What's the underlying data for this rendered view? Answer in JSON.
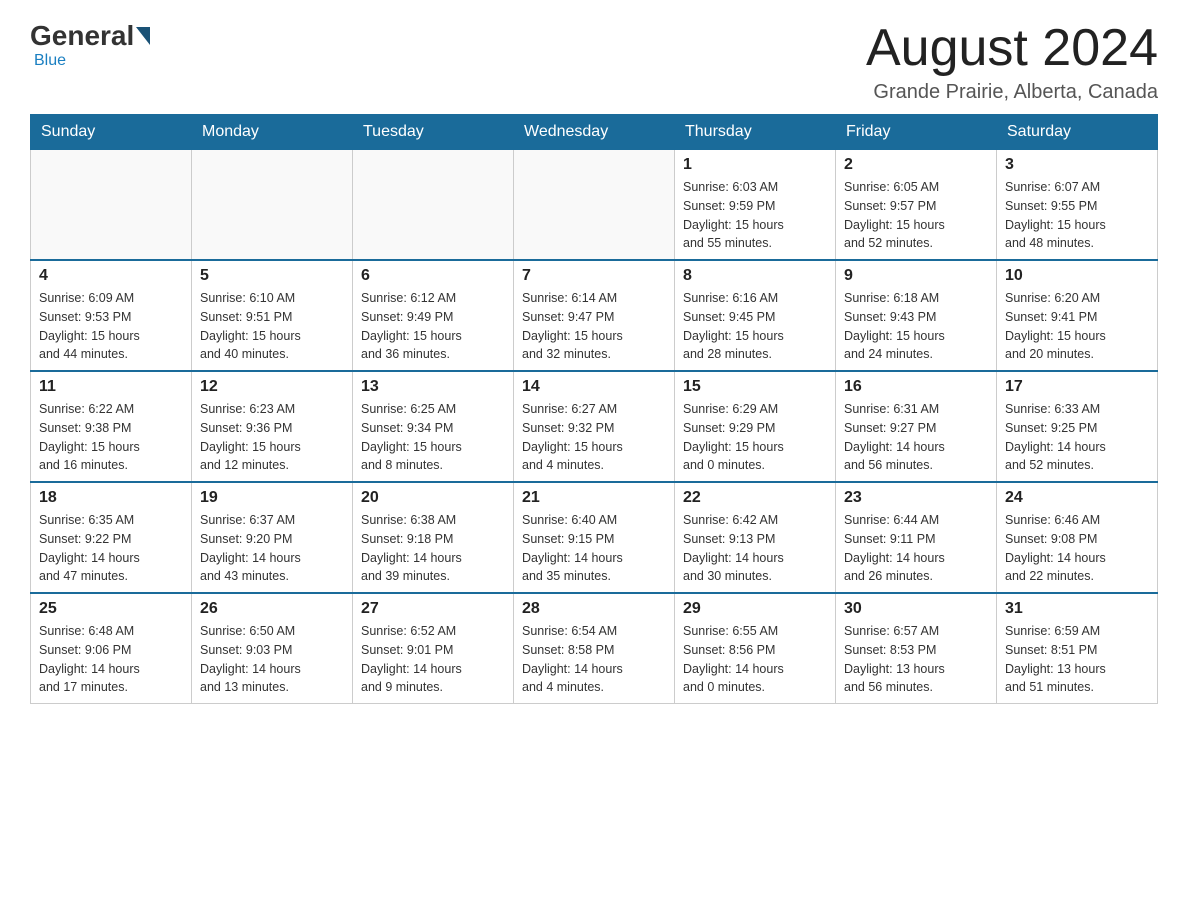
{
  "header": {
    "logo_general": "General",
    "logo_blue": "Blue",
    "month_title": "August 2024",
    "location": "Grande Prairie, Alberta, Canada"
  },
  "days_of_week": [
    "Sunday",
    "Monday",
    "Tuesday",
    "Wednesday",
    "Thursday",
    "Friday",
    "Saturday"
  ],
  "weeks": [
    [
      {
        "num": "",
        "info": ""
      },
      {
        "num": "",
        "info": ""
      },
      {
        "num": "",
        "info": ""
      },
      {
        "num": "",
        "info": ""
      },
      {
        "num": "1",
        "info": "Sunrise: 6:03 AM\nSunset: 9:59 PM\nDaylight: 15 hours\nand 55 minutes."
      },
      {
        "num": "2",
        "info": "Sunrise: 6:05 AM\nSunset: 9:57 PM\nDaylight: 15 hours\nand 52 minutes."
      },
      {
        "num": "3",
        "info": "Sunrise: 6:07 AM\nSunset: 9:55 PM\nDaylight: 15 hours\nand 48 minutes."
      }
    ],
    [
      {
        "num": "4",
        "info": "Sunrise: 6:09 AM\nSunset: 9:53 PM\nDaylight: 15 hours\nand 44 minutes."
      },
      {
        "num": "5",
        "info": "Sunrise: 6:10 AM\nSunset: 9:51 PM\nDaylight: 15 hours\nand 40 minutes."
      },
      {
        "num": "6",
        "info": "Sunrise: 6:12 AM\nSunset: 9:49 PM\nDaylight: 15 hours\nand 36 minutes."
      },
      {
        "num": "7",
        "info": "Sunrise: 6:14 AM\nSunset: 9:47 PM\nDaylight: 15 hours\nand 32 minutes."
      },
      {
        "num": "8",
        "info": "Sunrise: 6:16 AM\nSunset: 9:45 PM\nDaylight: 15 hours\nand 28 minutes."
      },
      {
        "num": "9",
        "info": "Sunrise: 6:18 AM\nSunset: 9:43 PM\nDaylight: 15 hours\nand 24 minutes."
      },
      {
        "num": "10",
        "info": "Sunrise: 6:20 AM\nSunset: 9:41 PM\nDaylight: 15 hours\nand 20 minutes."
      }
    ],
    [
      {
        "num": "11",
        "info": "Sunrise: 6:22 AM\nSunset: 9:38 PM\nDaylight: 15 hours\nand 16 minutes."
      },
      {
        "num": "12",
        "info": "Sunrise: 6:23 AM\nSunset: 9:36 PM\nDaylight: 15 hours\nand 12 minutes."
      },
      {
        "num": "13",
        "info": "Sunrise: 6:25 AM\nSunset: 9:34 PM\nDaylight: 15 hours\nand 8 minutes."
      },
      {
        "num": "14",
        "info": "Sunrise: 6:27 AM\nSunset: 9:32 PM\nDaylight: 15 hours\nand 4 minutes."
      },
      {
        "num": "15",
        "info": "Sunrise: 6:29 AM\nSunset: 9:29 PM\nDaylight: 15 hours\nand 0 minutes."
      },
      {
        "num": "16",
        "info": "Sunrise: 6:31 AM\nSunset: 9:27 PM\nDaylight: 14 hours\nand 56 minutes."
      },
      {
        "num": "17",
        "info": "Sunrise: 6:33 AM\nSunset: 9:25 PM\nDaylight: 14 hours\nand 52 minutes."
      }
    ],
    [
      {
        "num": "18",
        "info": "Sunrise: 6:35 AM\nSunset: 9:22 PM\nDaylight: 14 hours\nand 47 minutes."
      },
      {
        "num": "19",
        "info": "Sunrise: 6:37 AM\nSunset: 9:20 PM\nDaylight: 14 hours\nand 43 minutes."
      },
      {
        "num": "20",
        "info": "Sunrise: 6:38 AM\nSunset: 9:18 PM\nDaylight: 14 hours\nand 39 minutes."
      },
      {
        "num": "21",
        "info": "Sunrise: 6:40 AM\nSunset: 9:15 PM\nDaylight: 14 hours\nand 35 minutes."
      },
      {
        "num": "22",
        "info": "Sunrise: 6:42 AM\nSunset: 9:13 PM\nDaylight: 14 hours\nand 30 minutes."
      },
      {
        "num": "23",
        "info": "Sunrise: 6:44 AM\nSunset: 9:11 PM\nDaylight: 14 hours\nand 26 minutes."
      },
      {
        "num": "24",
        "info": "Sunrise: 6:46 AM\nSunset: 9:08 PM\nDaylight: 14 hours\nand 22 minutes."
      }
    ],
    [
      {
        "num": "25",
        "info": "Sunrise: 6:48 AM\nSunset: 9:06 PM\nDaylight: 14 hours\nand 17 minutes."
      },
      {
        "num": "26",
        "info": "Sunrise: 6:50 AM\nSunset: 9:03 PM\nDaylight: 14 hours\nand 13 minutes."
      },
      {
        "num": "27",
        "info": "Sunrise: 6:52 AM\nSunset: 9:01 PM\nDaylight: 14 hours\nand 9 minutes."
      },
      {
        "num": "28",
        "info": "Sunrise: 6:54 AM\nSunset: 8:58 PM\nDaylight: 14 hours\nand 4 minutes."
      },
      {
        "num": "29",
        "info": "Sunrise: 6:55 AM\nSunset: 8:56 PM\nDaylight: 14 hours\nand 0 minutes."
      },
      {
        "num": "30",
        "info": "Sunrise: 6:57 AM\nSunset: 8:53 PM\nDaylight: 13 hours\nand 56 minutes."
      },
      {
        "num": "31",
        "info": "Sunrise: 6:59 AM\nSunset: 8:51 PM\nDaylight: 13 hours\nand 51 minutes."
      }
    ]
  ]
}
